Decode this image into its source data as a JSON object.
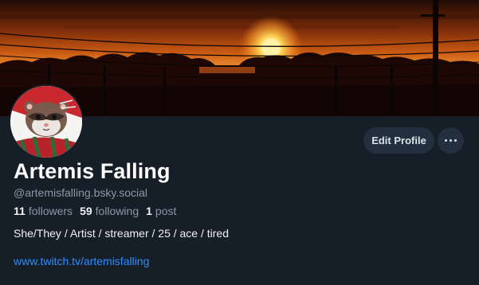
{
  "profile": {
    "display_name": "Artemis Falling",
    "handle": "@artemisfalling.bsky.social",
    "bio": "She/They / Artist / streamer / 25 / ace / tired",
    "link": "www.twitch.tv/artemisfalling"
  },
  "stats": {
    "followers_count": "11",
    "followers_label": "followers",
    "following_count": "59",
    "following_label": "following",
    "posts_count": "1",
    "posts_label": "post"
  },
  "actions": {
    "edit_profile_label": "Edit Profile",
    "more_icon": "more-horizontal-icon"
  },
  "colors": {
    "background": "#161e27",
    "button_bg": "#232e3e",
    "link": "#2f8bff",
    "muted_text": "#8b98a7"
  }
}
